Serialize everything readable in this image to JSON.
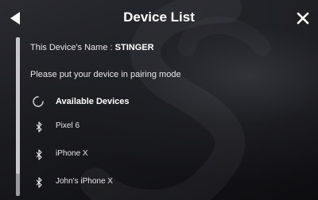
{
  "header": {
    "title": "Device List",
    "back_icon": "back-arrow-icon",
    "close_icon": "close-icon"
  },
  "device_info": {
    "label": "This Device's Name : ",
    "name": "STINGER"
  },
  "instruction": "Please put your device in pairing mode",
  "available": {
    "label": "Available Devices",
    "icon": "loading-spinner-icon"
  },
  "devices": [
    {
      "name": "Pixel 6",
      "icon": "bluetooth-icon"
    },
    {
      "name": "iPhone X",
      "icon": "bluetooth-icon"
    },
    {
      "name": "John's iPhone X",
      "icon": "bluetooth-icon"
    }
  ],
  "scroll": {
    "visible_fraction": 0.86
  },
  "colors": {
    "text": "#ffffff",
    "background": "#1a1b1f",
    "scrollbar": "#9a9aa0"
  }
}
